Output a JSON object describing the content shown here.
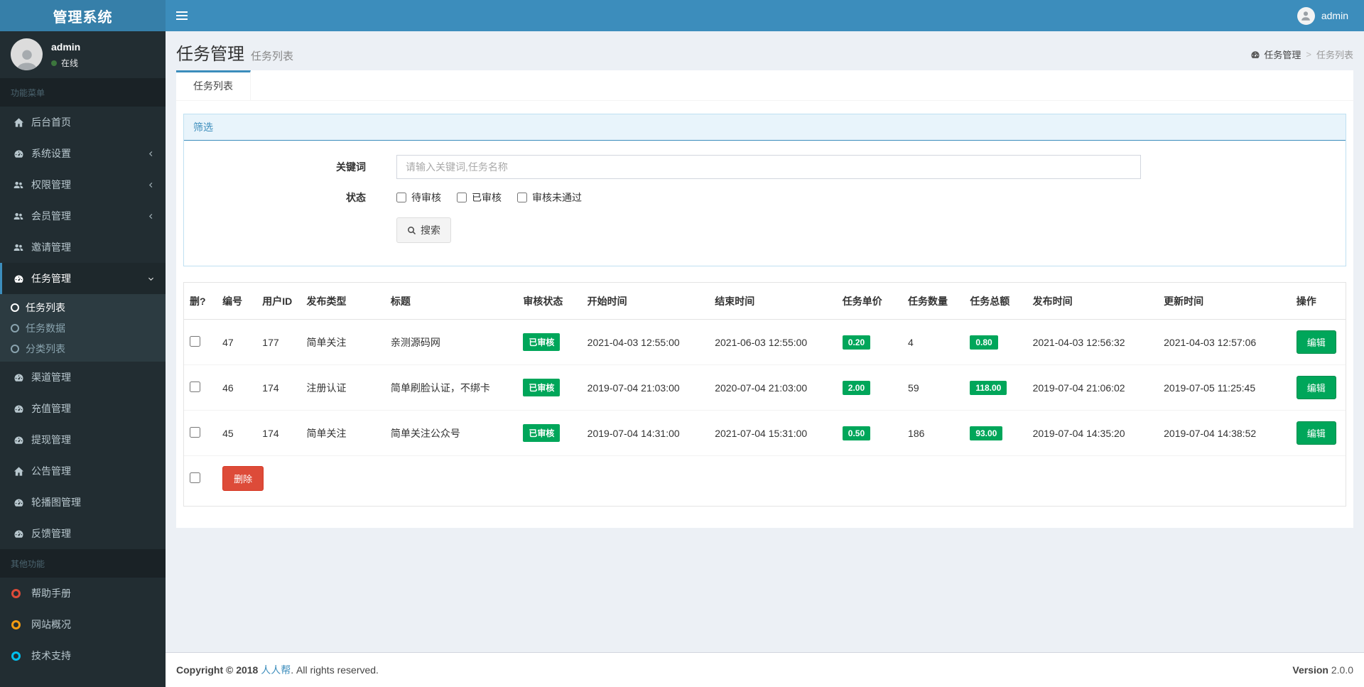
{
  "colors": {
    "topbar": "#3c8dbc",
    "logo_bg": "#367fa9",
    "sidebar_bg": "#222d32",
    "accent": "#3c8dbc",
    "success": "#00a65a",
    "danger": "#dd4b39",
    "filter_header_bg": "#e8f4fb",
    "online_dot": "#3c763d"
  },
  "topbar": {
    "brand": "管理系统",
    "user": "admin"
  },
  "sidebar": {
    "user": {
      "name": "admin",
      "status": "在线"
    },
    "menu_header": "功能菜单",
    "items": [
      {
        "label": "后台首页",
        "icon": "home-icon"
      },
      {
        "label": "系统设置",
        "icon": "gauge-icon",
        "chevron": "left"
      },
      {
        "label": "权限管理",
        "icon": "users-icon",
        "chevron": "left"
      },
      {
        "label": "会员管理",
        "icon": "users-icon",
        "chevron": "left"
      },
      {
        "label": "邀请管理",
        "icon": "users-icon"
      },
      {
        "label": "任务管理",
        "icon": "gauge-icon",
        "chevron": "down",
        "active": true
      },
      {
        "label": "渠道管理",
        "icon": "gauge-icon"
      },
      {
        "label": "充值管理",
        "icon": "gauge-icon"
      },
      {
        "label": "提现管理",
        "icon": "gauge-icon"
      },
      {
        "label": "公告管理",
        "icon": "home-icon"
      },
      {
        "label": "轮播图管理",
        "icon": "gauge-icon"
      },
      {
        "label": "反馈管理",
        "icon": "gauge-icon"
      }
    ],
    "submenu": [
      {
        "label": "任务列表",
        "active": true
      },
      {
        "label": "任务数据"
      },
      {
        "label": "分类列表"
      }
    ],
    "other_header": "其他功能",
    "other_items": [
      {
        "label": "帮助手册",
        "dot_color": "#dd4b39"
      },
      {
        "label": "网站概况",
        "dot_color": "#f39c12"
      },
      {
        "label": "技术支持",
        "dot_color": "#00c0ef"
      }
    ]
  },
  "page": {
    "title": "任务管理",
    "subtitle": "任务列表",
    "tab": "任务列表",
    "breadcrumb": {
      "parent": "任务管理",
      "separator": ">",
      "current": "任务列表"
    }
  },
  "filter": {
    "panel_title": "筛选",
    "keyword_label": "关键词",
    "keyword_placeholder": "请输入关键词,任务名称",
    "keyword_value": "",
    "status_label": "状态",
    "status_options": [
      "待审核",
      "已审核",
      "审核未通过"
    ],
    "search_label": "搜索"
  },
  "table": {
    "headers": [
      "删?",
      "编号",
      "用户ID",
      "发布类型",
      "标题",
      "审核状态",
      "开始时间",
      "结束时间",
      "任务单价",
      "任务数量",
      "任务总额",
      "发布时间",
      "更新时间",
      "操作"
    ],
    "rows": [
      {
        "id": "47",
        "user_id": "177",
        "publish_type": "简单关注",
        "title": "亲测源码网",
        "status": "已审核",
        "start_time": "2021-04-03 12:55:00",
        "end_time": "2021-06-03 12:55:00",
        "unit_price": "0.20",
        "quantity": "4",
        "total": "0.80",
        "publish_time": "2021-04-03 12:56:32",
        "update_time": "2021-04-03 12:57:06",
        "edit_label": "编辑"
      },
      {
        "id": "46",
        "user_id": "174",
        "publish_type": "注册认证",
        "title": "简单刷脸认证，不绑卡",
        "status": "已审核",
        "start_time": "2019-07-04 21:03:00",
        "end_time": "2020-07-04 21:03:00",
        "unit_price": "2.00",
        "quantity": "59",
        "total": "118.00",
        "publish_time": "2019-07-04 21:06:02",
        "update_time": "2019-07-05 11:25:45",
        "edit_label": "编辑"
      },
      {
        "id": "45",
        "user_id": "174",
        "publish_type": "简单关注",
        "title": "简单关注公众号",
        "status": "已审核",
        "start_time": "2019-07-04 14:31:00",
        "end_time": "2021-07-04 15:31:00",
        "unit_price": "0.50",
        "quantity": "186",
        "total": "93.00",
        "publish_time": "2019-07-04 14:35:20",
        "update_time": "2019-07-04 14:38:52",
        "edit_label": "编辑"
      }
    ],
    "delete_label": "删除"
  },
  "footer": {
    "copyright": "Copyright © 2018",
    "brand": "人人帮",
    "rights": ". All rights reserved.",
    "version_label": "Version",
    "version": "2.0.0"
  }
}
